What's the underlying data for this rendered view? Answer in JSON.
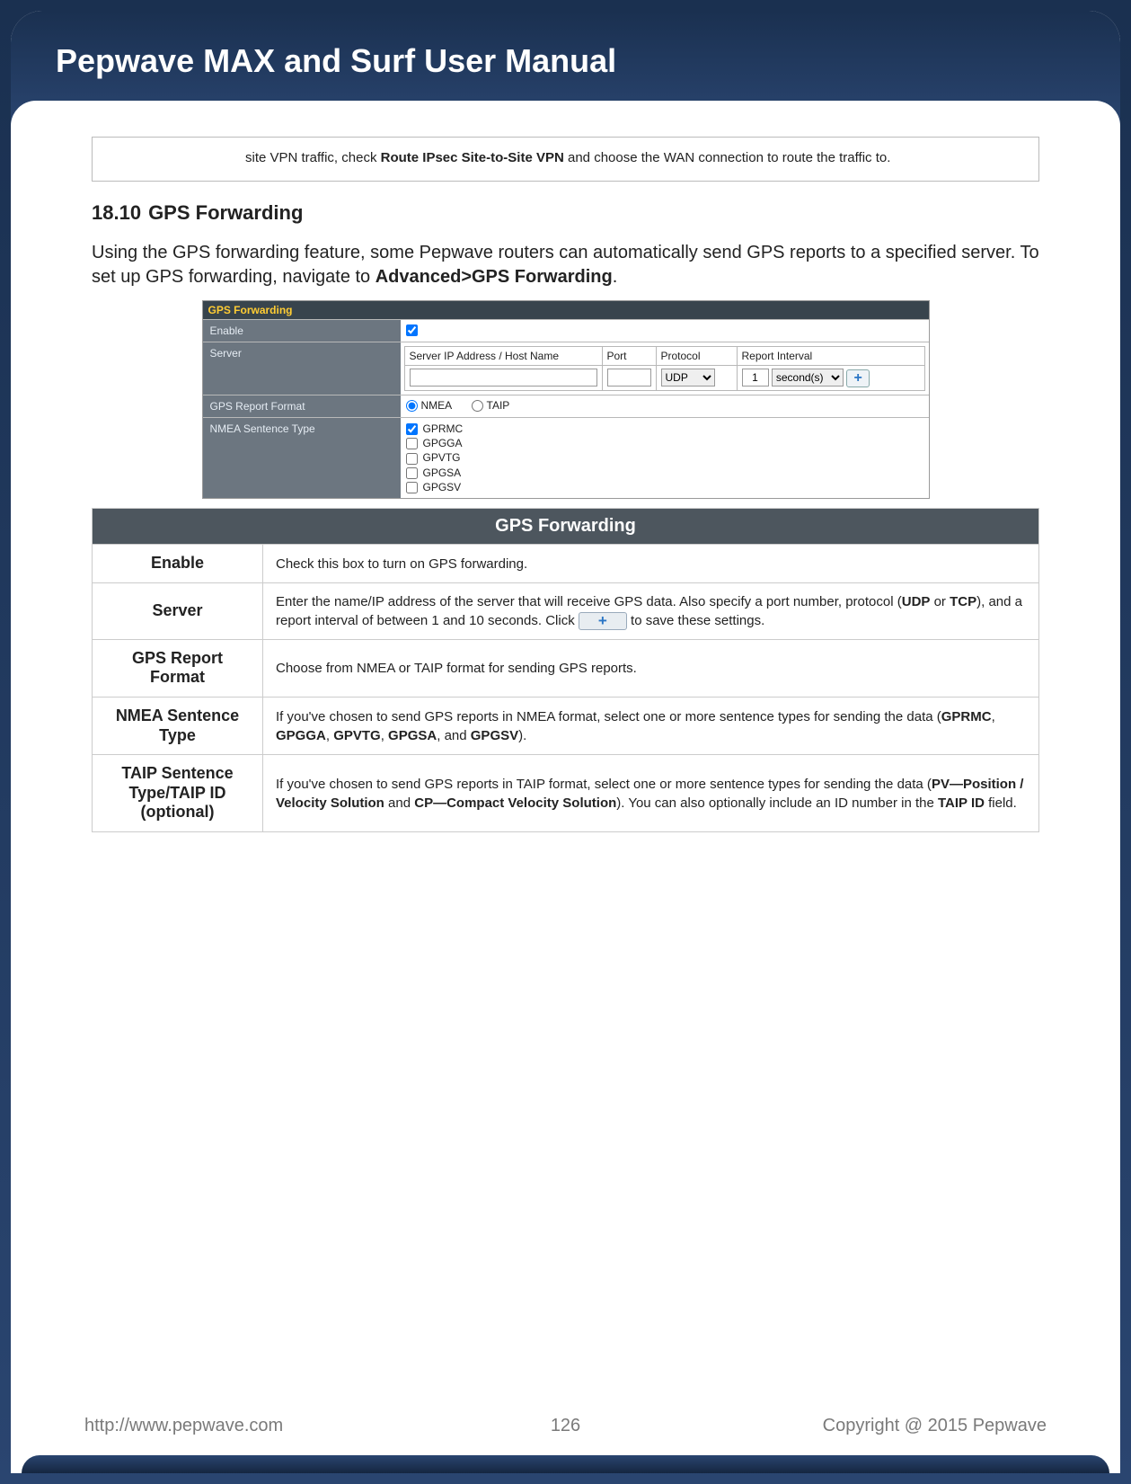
{
  "header": {
    "title": "Pepwave MAX and Surf User Manual"
  },
  "topbox": {
    "pre": "site VPN traffic, check ",
    "bold": "Route IPsec Site-to-Site VPN",
    "post": " and choose the WAN connection to route the traffic to."
  },
  "section": {
    "num": "18.10",
    "title": "GPS Forwarding"
  },
  "intro": {
    "p1a": "Using the GPS forwarding feature, some Pepwave routers can automatically send GPS reports to a specified server. To set up GPS forwarding, navigate to ",
    "p1b": "Advanced>GPS Forwarding",
    "p1c": "."
  },
  "config": {
    "title": "GPS Forwarding",
    "rows": {
      "enable": "Enable",
      "server": "Server",
      "format": "GPS Report Format",
      "nmea": "NMEA Sentence Type"
    },
    "server_header": {
      "ip": "Server IP Address / Host Name",
      "port": "Port",
      "proto": "Protocol",
      "interval": "Report Interval"
    },
    "server_row": {
      "proto_val": "UDP",
      "int_val": "1",
      "sec_val": "second(s)"
    },
    "format_opts": {
      "nmea": "NMEA",
      "taip": "TAIP"
    },
    "nmea_opts": [
      "GPRMC",
      "GPGGA",
      "GPVTG",
      "GPGSA",
      "GPGSV"
    ],
    "add": "+"
  },
  "desc": {
    "header": "GPS Forwarding",
    "enable": {
      "label": "Enable",
      "text": "Check this box to turn on GPS forwarding."
    },
    "server": {
      "label": "Server",
      "t1": "Enter the name/IP address of the server that will receive GPS data. Also specify a port number, protocol (",
      "b1": "UDP",
      "t2": " or ",
      "b2": "TCP",
      "t3": "), and a report interval of between 1 and 10 seconds. Click ",
      "plus": "+",
      "t4": " to save these settings."
    },
    "format": {
      "label": "GPS Report Format",
      "text": "Choose from NMEA or TAIP format for sending GPS reports."
    },
    "nmea": {
      "label": "NMEA Sentence Type",
      "t1": "If you've chosen to send GPS reports in NMEA format, select one or more sentence types for sending the data (",
      "b1": "GPRMC",
      "c1": ", ",
      "b2": "GPGGA",
      "c2": ", ",
      "b3": "GPVTG",
      "c3": ", ",
      "b4": "GPGSA",
      "c4": ", and ",
      "b5": "GPGSV",
      "t2": ")."
    },
    "taip": {
      "label": "TAIP Sentence Type/TAIP ID (optional)",
      "t1": "If you've chosen to send GPS reports in TAIP format, select one or more sentence types for sending the data (",
      "b1": "PV—Position / Velocity Solution",
      "c1": " and ",
      "b2": "CP—Compact Velocity Solution",
      "t2": "). You can also optionally include an ID number in the ",
      "b3": "TAIP ID",
      "t3": " field."
    }
  },
  "footer": {
    "url": "http://www.pepwave.com",
    "page": "126",
    "copyright": "Copyright @ 2015 Pepwave"
  }
}
